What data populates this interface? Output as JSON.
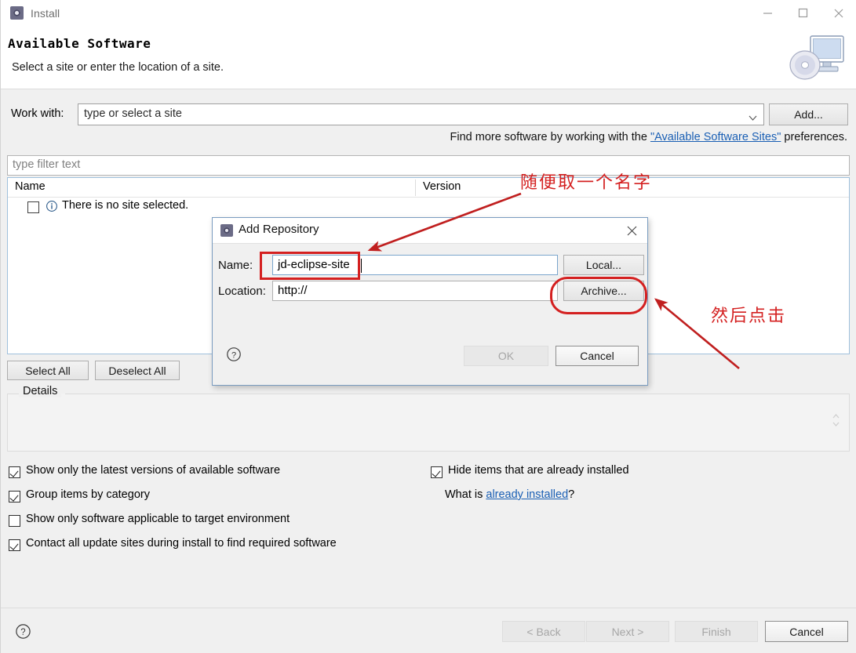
{
  "window": {
    "title": "Install",
    "icon": "eclipse-icon",
    "minimize": "minimize-icon",
    "maximize": "maximize-icon",
    "close": "close-icon"
  },
  "header": {
    "title": "Available Software",
    "subtitle": "Select a site or enter the location of a site.",
    "banner_icon": "computer-disc-icon"
  },
  "work_with": {
    "label": "Work with:",
    "value": "type or select a site",
    "placeholder": "type or select a site",
    "add_button": "Add..."
  },
  "hint": {
    "prefix": "Find more software by working with the ",
    "link": "\"Available Software Sites\"",
    "suffix": " preferences."
  },
  "filter": {
    "placeholder": "type filter text",
    "value": ""
  },
  "table": {
    "columns": [
      "Name",
      "Version"
    ],
    "rows": [
      {
        "checked": false,
        "icon": "info-icon",
        "name": "There is no site selected.",
        "version": ""
      }
    ]
  },
  "buttons": {
    "select_all": "Select All",
    "deselect_all": "Deselect All"
  },
  "details": {
    "legend": "Details",
    "content": "",
    "spinner": "spinner-up-down-icon"
  },
  "options": {
    "left": [
      {
        "label": "Show only the latest versions of available software",
        "checked": true
      },
      {
        "label": "Group items by category",
        "checked": true
      },
      {
        "label": "Show only software applicable to target environment",
        "checked": false
      },
      {
        "label": "Contact all update sites during install to find required software",
        "checked": true
      }
    ],
    "right": [
      {
        "label": "Hide items that are already installed",
        "checked": true
      }
    ],
    "what_is": {
      "prefix": "What is ",
      "link": "already installed",
      "suffix": "?"
    }
  },
  "footer": {
    "help": "help-icon",
    "back": "< Back",
    "next": "Next >",
    "finish": "Finish",
    "cancel": "Cancel"
  },
  "modal": {
    "title": "Add Repository",
    "icon": "eclipse-icon",
    "close": "close-icon",
    "name_label": "Name:",
    "name_value": "jd-eclipse-site",
    "local_button": "Local...",
    "location_label": "Location:",
    "location_value": "http://",
    "archive_button": "Archive...",
    "help": "help-icon",
    "ok": "OK",
    "cancel": "Cancel"
  },
  "annotations": {
    "color": "#d42020",
    "note_name": "随便取一个名字",
    "note_archive": "然后点击"
  }
}
